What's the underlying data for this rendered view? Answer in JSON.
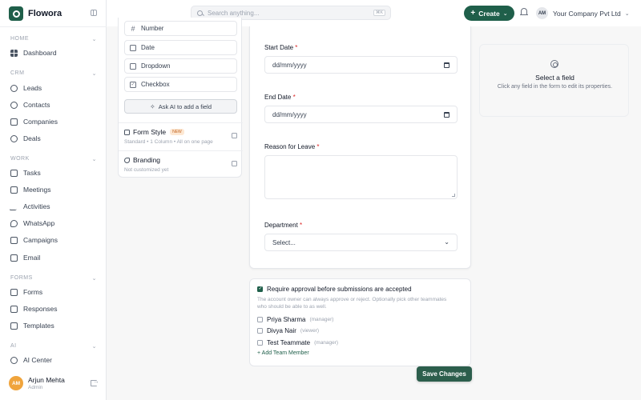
{
  "app": {
    "name": "Flowora"
  },
  "colors": {
    "brand": "#1f5f4a",
    "required": "#dc2626",
    "avatar": "#f0a43c"
  },
  "topbar": {
    "search_placeholder": "Search anything...",
    "search_shortcut": "⌘K",
    "create_label": "Create",
    "company_initials": "AM",
    "company_name": "Your Company Pvt Ltd"
  },
  "sidebar": {
    "sections": [
      {
        "title": "HOME",
        "items": [
          {
            "label": "Dashboard",
            "icon": "grid-icon"
          }
        ]
      },
      {
        "title": "CRM",
        "items": [
          {
            "label": "Leads",
            "icon": "user-plus-icon"
          },
          {
            "label": "Contacts",
            "icon": "users-icon"
          },
          {
            "label": "Companies",
            "icon": "building-icon"
          },
          {
            "label": "Deals",
            "icon": "target-icon"
          }
        ]
      },
      {
        "title": "WORK",
        "items": [
          {
            "label": "Tasks",
            "icon": "checklist-icon"
          },
          {
            "label": "Meetings",
            "icon": "calendar-icon"
          },
          {
            "label": "Activities",
            "icon": "pulse-icon"
          },
          {
            "label": "WhatsApp",
            "icon": "chat-icon"
          },
          {
            "label": "Campaigns",
            "icon": "megaphone-icon"
          },
          {
            "label": "Email",
            "icon": "mail-icon"
          }
        ]
      },
      {
        "title": "FORMS",
        "items": [
          {
            "label": "Forms",
            "icon": "form-icon"
          },
          {
            "label": "Responses",
            "icon": "inbox-icon"
          },
          {
            "label": "Templates",
            "icon": "template-icon"
          }
        ]
      },
      {
        "title": "AI",
        "items": [
          {
            "label": "AI Center",
            "icon": "sparkle-icon"
          }
        ]
      }
    ],
    "user": {
      "initials": "AM",
      "name": "Arjun Mehta",
      "role": "Admin"
    }
  },
  "palette": {
    "fields": [
      "Number",
      "Date",
      "Dropdown",
      "Checkbox"
    ],
    "ai_button": "Ask AI to add a field",
    "form_style": {
      "title": "Form Style",
      "badge": "NEW",
      "subtitle": "Standard • 1 Column • All on one page"
    },
    "branding": {
      "title": "Branding",
      "subtitle": "Not customized yet"
    }
  },
  "form": {
    "start_date": {
      "label": "Start Date",
      "required": "*",
      "placeholder": "dd/mm/yyyy"
    },
    "end_date": {
      "label": "End Date",
      "required": "*",
      "placeholder": "dd/mm/yyyy"
    },
    "reason": {
      "label": "Reason for Leave",
      "required": "*"
    },
    "department": {
      "label": "Department",
      "required": "*",
      "value": "Select..."
    }
  },
  "approval": {
    "require_label": "Require approval before submissions are accepted",
    "require_checked": true,
    "help": "The account owner can always approve or reject. Optionally pick other teammates who should be able to as well.",
    "members": [
      {
        "name": "Priya Sharma",
        "role": "(manager)"
      },
      {
        "name": "Divya Nair",
        "role": "(viewer)"
      },
      {
        "name": "Test Teammate",
        "role": "(manager)"
      }
    ],
    "add_member": "+ Add Team Member"
  },
  "save_label": "Save Changes",
  "properties": {
    "title": "Select a field",
    "subtitle": "Click any field in the form to edit its properties."
  }
}
